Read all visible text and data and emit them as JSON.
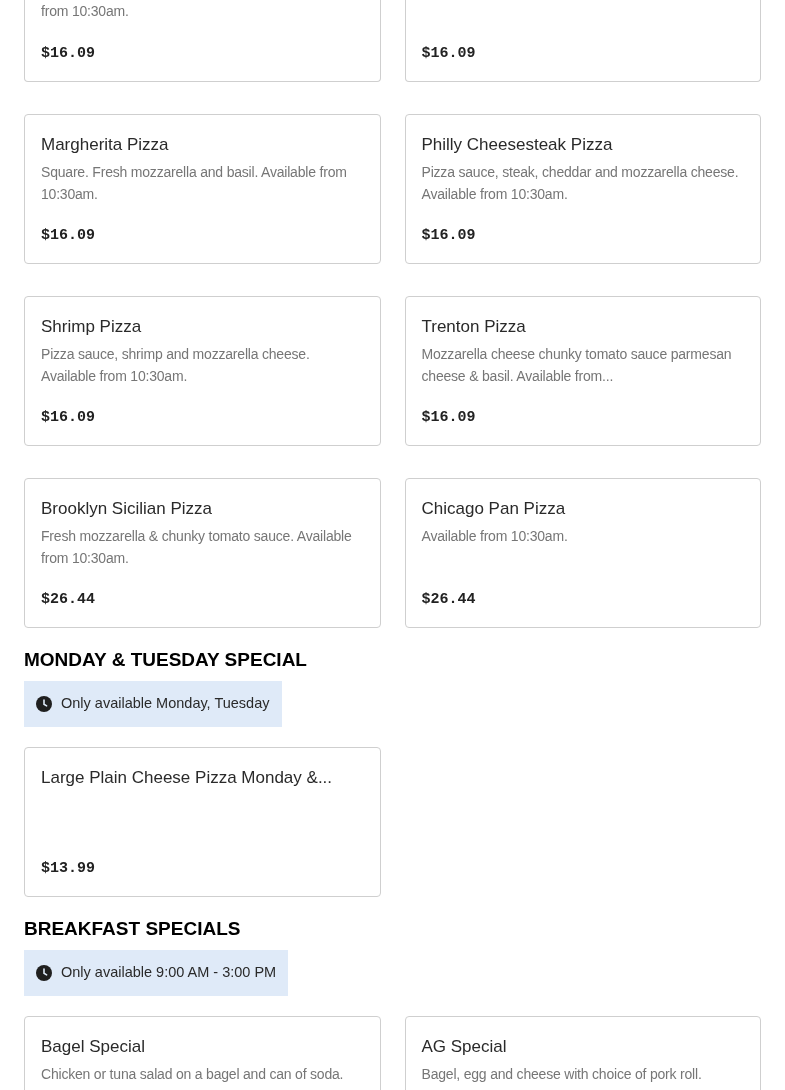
{
  "top_cards": [
    {
      "description": "from 10:30am.",
      "price": "$16.09"
    },
    {
      "price": "$16.09"
    }
  ],
  "cards": [
    {
      "name": "Margherita Pizza",
      "description": "Square. Fresh mozzarella and basil. Available from 10:30am.",
      "price": "$16.09"
    },
    {
      "name": "Philly Cheesesteak Pizza",
      "description": "Pizza sauce, steak, cheddar and mozzarella cheese. Available from 10:30am.",
      "price": "$16.09"
    },
    {
      "name": "Shrimp Pizza",
      "description": "Pizza sauce, shrimp and mozzarella cheese. Available from 10:30am.",
      "price": "$16.09"
    },
    {
      "name": "Trenton Pizza",
      "description": "Mozzarella cheese chunky tomato sauce parmesan cheese & basil. Available from...",
      "price": "$16.09"
    },
    {
      "name": "Brooklyn Sicilian Pizza",
      "description": "Fresh mozzarella & chunky tomato sauce. Available from 10:30am.",
      "price": "$26.44"
    },
    {
      "name": "Chicago Pan Pizza",
      "description": "Available from 10:30am.",
      "price": "$26.44"
    }
  ],
  "sections": [
    {
      "title": "MONDAY & TUESDAY SPECIAL",
      "availability": "Only available Monday, Tuesday",
      "cards": [
        {
          "name": "Large Plain Cheese Pizza Monday &...",
          "price": "$13.99"
        }
      ]
    },
    {
      "title": "BREAKFAST SPECIALS",
      "availability": "Only available 9:00 AM - 3:00 PM",
      "cards": [
        {
          "name": "Bagel Special",
          "description": "Chicken or tuna salad on a bagel and can of soda."
        },
        {
          "name": "AG Special",
          "description": "Bagel, egg and cheese with choice of pork roll."
        }
      ]
    }
  ]
}
